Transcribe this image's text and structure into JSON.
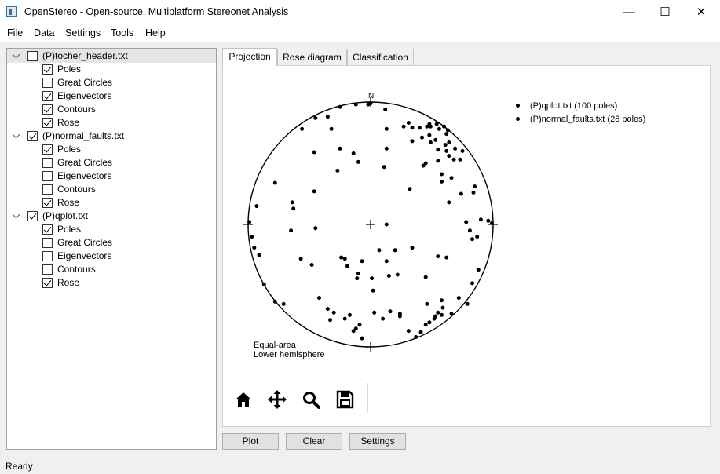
{
  "window": {
    "title": "OpenStereo - Open-source, Multiplatform Stereonet Analysis",
    "controls": [
      "—",
      "☐",
      "✕"
    ]
  },
  "menu": [
    "File",
    "Data",
    "Settings",
    "Tools",
    "Help"
  ],
  "tree": [
    {
      "label": "(P)tocher_header.txt",
      "checked": false,
      "expanded": true,
      "selected": true,
      "children": [
        {
          "label": "Poles",
          "checked": true
        },
        {
          "label": "Great Circles",
          "checked": false
        },
        {
          "label": "Eigenvectors",
          "checked": true
        },
        {
          "label": "Contours",
          "checked": true
        },
        {
          "label": "Rose",
          "checked": true
        }
      ]
    },
    {
      "label": "(P)normal_faults.txt",
      "checked": true,
      "expanded": true,
      "selected": false,
      "children": [
        {
          "label": "Poles",
          "checked": true
        },
        {
          "label": "Great Circles",
          "checked": false
        },
        {
          "label": "Eigenvectors",
          "checked": false
        },
        {
          "label": "Contours",
          "checked": false
        },
        {
          "label": "Rose",
          "checked": true
        }
      ]
    },
    {
      "label": "(P)qplot.txt",
      "checked": true,
      "expanded": true,
      "selected": false,
      "children": [
        {
          "label": "Poles",
          "checked": true
        },
        {
          "label": "Great Circles",
          "checked": false
        },
        {
          "label": "Eigenvectors",
          "checked": false
        },
        {
          "label": "Contours",
          "checked": false
        },
        {
          "label": "Rose",
          "checked": true
        }
      ]
    }
  ],
  "tabs": [
    {
      "label": "Projection",
      "active": true
    },
    {
      "label": "Rose diagram",
      "active": false
    },
    {
      "label": "Classification",
      "active": false
    }
  ],
  "plot": {
    "north_label": "N",
    "legend": [
      "(P)qplot.txt (100 poles)",
      "(P)normal_faults.txt (28 poles)"
    ],
    "projection_lines": [
      "Equal-area",
      "Lower hemisphere"
    ],
    "poles": [
      [
        -0.25,
        0.96
      ],
      [
        -0.12,
        0.98
      ],
      [
        -0.02,
        0.98
      ],
      [
        0.0,
        0.99
      ],
      [
        -0.56,
        0.78
      ],
      [
        -0.45,
        0.87
      ],
      [
        -0.35,
        0.88
      ],
      [
        0.12,
        0.94
      ],
      [
        0.31,
        0.83
      ],
      [
        0.27,
        0.8
      ],
      [
        0.34,
        0.79
      ],
      [
        0.49,
        0.8
      ],
      [
        0.4,
        0.79
      ],
      [
        0.48,
        0.82
      ],
      [
        0.54,
        0.82
      ],
      [
        0.6,
        0.8
      ],
      [
        0.56,
        0.78
      ],
      [
        0.46,
        0.8
      ],
      [
        0.48,
        0.73
      ],
      [
        0.63,
        0.77
      ],
      [
        0.53,
        0.69
      ],
      [
        0.49,
        0.67
      ],
      [
        0.61,
        0.65
      ],
      [
        0.64,
        0.67
      ],
      [
        0.69,
        0.62
      ],
      [
        0.75,
        0.6
      ],
      [
        0.62,
        0.6
      ],
      [
        0.64,
        0.56
      ],
      [
        0.55,
        0.61
      ],
      [
        0.68,
        0.53
      ],
      [
        0.73,
        0.53
      ],
      [
        0.55,
        0.52
      ],
      [
        0.45,
        0.5
      ],
      [
        0.58,
        0.41
      ],
      [
        0.43,
        0.48
      ],
      [
        0.66,
        0.38
      ],
      [
        0.85,
        0.31
      ],
      [
        0.84,
        0.26
      ],
      [
        0.64,
        0.18
      ],
      [
        0.78,
        0.02
      ],
      [
        0.9,
        0.04
      ],
      [
        0.96,
        0.03
      ],
      [
        0.81,
        -0.05
      ],
      [
        0.87,
        -0.1
      ],
      [
        -0.99,
        0.02
      ],
      [
        -0.97,
        -0.1
      ],
      [
        -0.95,
        -0.19
      ],
      [
        -0.91,
        -0.25
      ],
      [
        -0.65,
        -0.05
      ],
      [
        -0.57,
        -0.28
      ],
      [
        -0.48,
        -0.33
      ],
      [
        -0.87,
        -0.49
      ],
      [
        -0.78,
        -0.63
      ],
      [
        -0.71,
        -0.65
      ],
      [
        -0.42,
        -0.6
      ],
      [
        -0.35,
        -0.69
      ],
      [
        -0.3,
        -0.72
      ],
      [
        -0.21,
        -0.77
      ],
      [
        -0.17,
        -0.74
      ],
      [
        -0.09,
        -0.82
      ],
      [
        -0.14,
        -0.87
      ],
      [
        -0.07,
        -0.93
      ],
      [
        0.03,
        -0.72
      ],
      [
        0.1,
        -0.77
      ],
      [
        0.16,
        -0.71
      ],
      [
        0.24,
        -0.73
      ],
      [
        0.31,
        -0.87
      ],
      [
        0.37,
        -0.92
      ],
      [
        0.41,
        -0.88
      ],
      [
        0.45,
        -0.82
      ],
      [
        0.48,
        -0.8
      ],
      [
        0.52,
        -0.77
      ],
      [
        0.55,
        -0.72
      ],
      [
        0.58,
        -0.62
      ],
      [
        0.66,
        -0.73
      ],
      [
        0.72,
        -0.6
      ],
      [
        0.83,
        -0.48
      ],
      [
        0.62,
        -0.27
      ],
      [
        0.55,
        -0.26
      ],
      [
        0.45,
        -0.43
      ],
      [
        0.22,
        -0.41
      ],
      [
        0.15,
        -0.42
      ],
      [
        0.13,
        -0.3
      ],
      [
        0.2,
        -0.21
      ],
      [
        0.34,
        -0.19
      ],
      [
        0.07,
        -0.21
      ],
      [
        0.01,
        -0.44
      ],
      [
        -0.11,
        -0.44
      ],
      [
        -0.07,
        -0.3
      ],
      [
        -0.1,
        -0.4
      ],
      [
        -0.21,
        -0.28
      ],
      [
        -0.19,
        -0.34
      ],
      [
        -0.24,
        -0.27
      ],
      [
        -0.45,
        -0.03
      ],
      [
        -0.63,
        0.13
      ],
      [
        -0.64,
        0.18
      ],
      [
        -0.46,
        0.27
      ],
      [
        -0.78,
        0.34
      ],
      [
        -0.93,
        0.15
      ],
      [
        -0.27,
        0.44
      ],
      [
        -0.14,
        0.58
      ],
      [
        -0.1,
        0.51
      ],
      [
        -0.25,
        0.62
      ],
      [
        -0.46,
        0.59
      ],
      [
        -0.32,
        0.78
      ],
      [
        0.11,
        0.47
      ],
      [
        0.13,
        0.62
      ],
      [
        0.13,
        0.78
      ],
      [
        0.34,
        0.68
      ],
      [
        0.42,
        0.71
      ],
      [
        0.62,
        0.74
      ],
      [
        0.32,
        0.29
      ],
      [
        0.13,
        0.0
      ],
      [
        0.99,
        0.01
      ],
      [
        0.58,
        0.35
      ],
      [
        0.74,
        0.25
      ],
      [
        0.58,
        -0.74
      ],
      [
        0.79,
        -0.65
      ],
      [
        0.88,
        -0.37
      ],
      [
        0.83,
        -0.12
      ],
      [
        0.53,
        -0.75
      ],
      [
        0.59,
        -0.68
      ],
      [
        -0.12,
        -0.85
      ],
      [
        0.02,
        -0.54
      ],
      [
        0.24,
        -0.75
      ],
      [
        0.46,
        -0.65
      ],
      [
        -0.33,
        -0.78
      ]
    ]
  },
  "toolbar": [
    "home-icon",
    "pan-icon",
    "zoom-icon",
    "save-icon"
  ],
  "buttons": [
    "Plot",
    "Clear",
    "Settings"
  ],
  "status": "Ready"
}
